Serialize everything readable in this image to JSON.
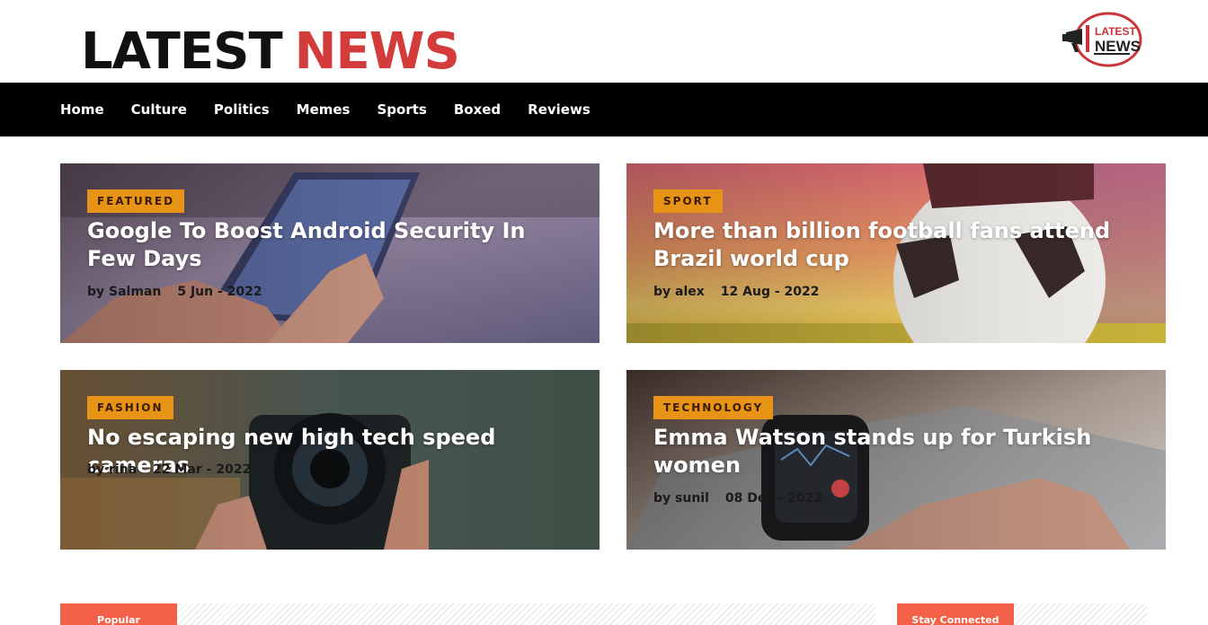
{
  "header": {
    "title_word1": "LATEST",
    "title_word2": "NEWS",
    "logo_line1": "LATEST",
    "logo_line2": "NEWS"
  },
  "nav": {
    "items": [
      {
        "label": "Home"
      },
      {
        "label": "Culture"
      },
      {
        "label": "Politics"
      },
      {
        "label": "Memes"
      },
      {
        "label": "Sports"
      },
      {
        "label": "Boxed"
      },
      {
        "label": "Reviews"
      }
    ]
  },
  "cards": [
    {
      "category": "FEATURED",
      "title": "Google To Boost Android Security In Few Days",
      "author": "by Salman",
      "date": "5 Jun - 2022",
      "image": "hand-holding-phone"
    },
    {
      "category": "SPORT",
      "title": "More than billion football fans attend Brazil world cup",
      "author": "by alex",
      "date": "12 Aug - 2022",
      "image": "football-at-sunset"
    },
    {
      "category": "FASHION",
      "title": "No escaping new high tech speed cameras",
      "author": "by rina",
      "date": "22 Mar - 2022",
      "image": "photographer-with-camera"
    },
    {
      "category": "TECHNOLOGY",
      "title": "Emma Watson stands up for Turkish women",
      "author": "by sunil",
      "date": "08 Dec - 2022",
      "image": "smartwatch-on-wrist"
    }
  ],
  "sections": {
    "popular": "Popular",
    "stay_connected": "Stay Connected"
  },
  "colors": {
    "accent_red": "#d43b3b",
    "category_badge": "#e69316",
    "section_tab": "#f26148",
    "nav_bg": "#000000"
  }
}
